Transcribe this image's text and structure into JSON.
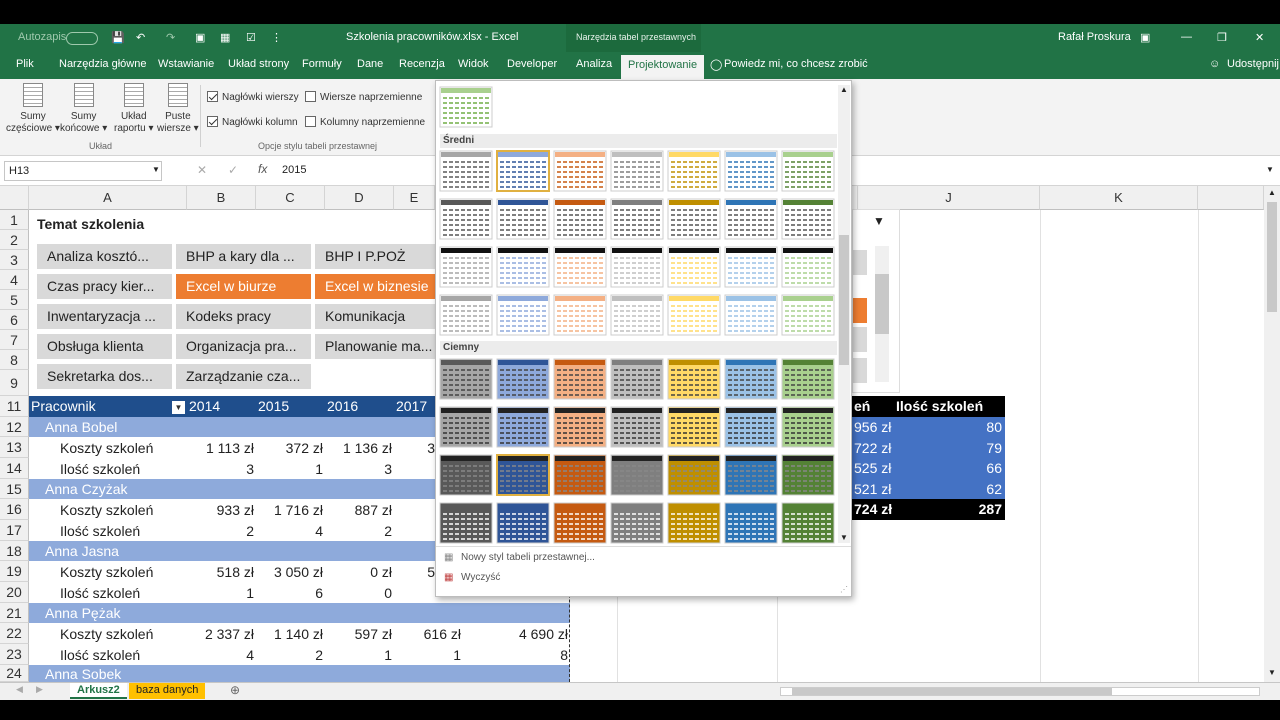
{
  "title": {
    "autosave": "Autozapis",
    "file": "Szkolenia pracowników.xlsx  -  Excel",
    "context": "Narzędzia tabel przestawnych",
    "user": "Rafał Proskura"
  },
  "tabs": [
    "Plik",
    "Narzędzia główne",
    "Wstawianie",
    "Układ strony",
    "Formuły",
    "Dane",
    "Recenzja",
    "Widok",
    "Developer",
    "Analiza",
    "Projektowanie"
  ],
  "tell": "Powiedz mi, co chcesz zrobić",
  "share": "Udostępnij",
  "ribbon": {
    "btn1a": "Sumy",
    "btn1b": "częściowe",
    "btn2a": "Sumy",
    "btn2b": "końcowe",
    "btn3a": "Układ",
    "btn3b": "raportu",
    "btn4a": "Puste",
    "btn4b": "wiersze",
    "group1": "Układ",
    "cb1": "Nagłówki wierszy",
    "cb2": "Wiersze naprzemienne",
    "cb3": "Nagłówki kolumn",
    "cb4": "Kolumny naprzemienne",
    "group2": "Opcje stylu tabeli przestawnej"
  },
  "formula": {
    "cell": "H13",
    "value": "2015",
    "fx": "fx"
  },
  "cols": [
    "A",
    "B",
    "C",
    "D",
    "E",
    "J",
    "K"
  ],
  "rows": [
    "1",
    "2",
    "3",
    "4",
    "5",
    "6",
    "7",
    "8",
    "9",
    "11",
    "12",
    "13",
    "14",
    "15",
    "16",
    "17",
    "18",
    "19",
    "20",
    "21",
    "22",
    "23",
    "24"
  ],
  "slicer": {
    "title": "Temat szkolenia",
    "items": [
      "Analiza kosztó...",
      "BHP a kary dla ...",
      "BHP I P.POŻ",
      "Czas pracy kier...",
      "Excel w biurze",
      "Excel w biznesie",
      "Inwentaryzacja ...",
      "Kodeks pracy",
      "Komunikacja",
      "Obsługa klienta",
      "Organizacja pra...",
      "Planowanie ma...",
      "Sekretarka dos...",
      "Zarządzanie cza..."
    ]
  },
  "pivot": {
    "header": "Pracownik",
    "years": [
      "2014",
      "2015",
      "2016",
      "2017"
    ],
    "g1": "Anna  Bobel",
    "g2": "Anna  Czyżak",
    "g3": "Anna  Jasna",
    "g4": "Anna  Pężak",
    "g5": "Anna  Sobek",
    "cost": "Koszty szkoleń",
    "cnt": "Ilość szkoleń",
    "r13": [
      "1 113 zł",
      "372 zł",
      "1 136 zł",
      "3"
    ],
    "r14": [
      "3",
      "1",
      "3"
    ],
    "r16": [
      "933 zł",
      "1 716 zł",
      "887 zł"
    ],
    "r17": [
      "2",
      "4",
      "2"
    ],
    "r19": [
      "518 zł",
      "3 050 zł",
      "0 zł",
      "5"
    ],
    "r20": [
      "1",
      "6",
      "0"
    ],
    "r22": [
      "2 337 zł",
      "1 140 zł",
      "597 zł",
      "616 zł",
      "4 690 zł"
    ],
    "r23": [
      "4",
      "2",
      "1",
      "1",
      "8"
    ]
  },
  "right": {
    "h1": "eń",
    "h2": "Ilość szkoleń",
    "v": [
      [
        "956 zł",
        "80"
      ],
      [
        "722 zł",
        "79"
      ],
      [
        "525 zł",
        "66"
      ],
      [
        "521 zł",
        "62"
      ]
    ],
    "total": [
      "724 zł",
      "287"
    ]
  },
  "gallery": {
    "sec1": "Średni",
    "sec2": "Ciemny",
    "new": "Nowy styl tabeli przestawnej...",
    "clear": "Wyczyść",
    "colors_light": [
      "#a6a6a6",
      "#8ea9db",
      "#f4b084",
      "#bfbfbf",
      "#ffd966",
      "#9bc2e6",
      "#a9d08e"
    ],
    "colors_dark": [
      "#595959",
      "#2f5597",
      "#c55a11",
      "#7f7f7f",
      "#bf8f00",
      "#2e75b6",
      "#548235"
    ]
  },
  "sheets": [
    "Arkusz2",
    "baza danych"
  ]
}
